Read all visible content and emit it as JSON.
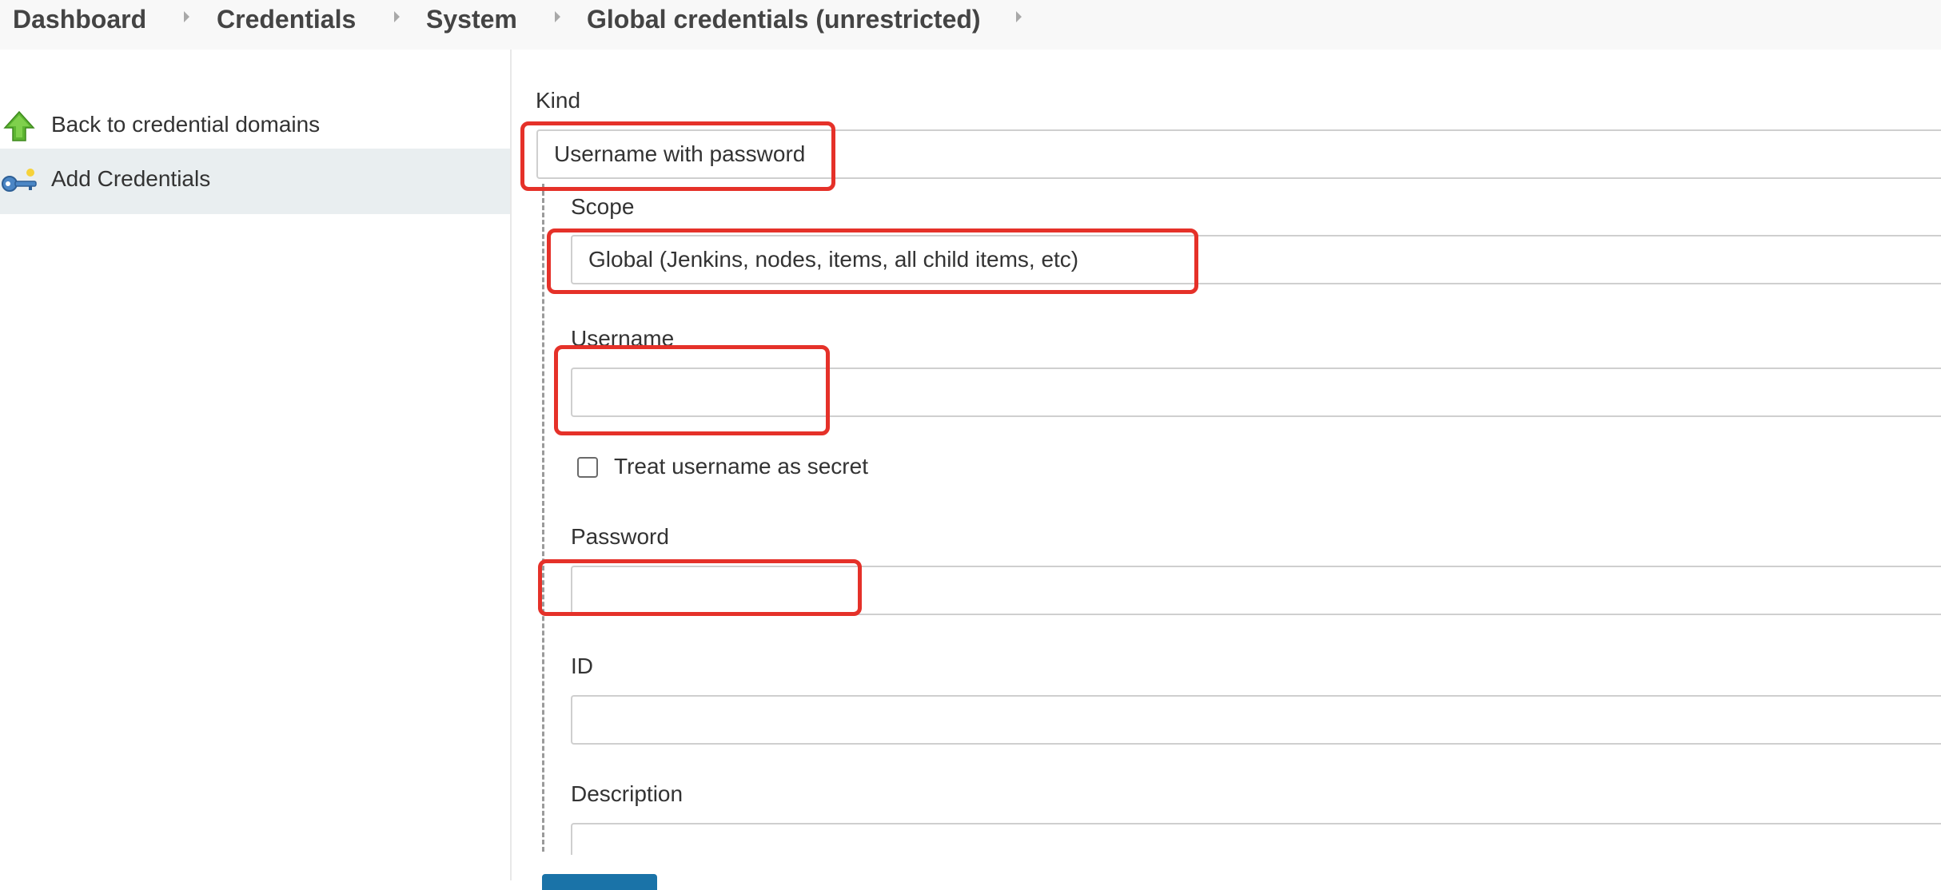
{
  "breadcrumb": {
    "items": [
      "Dashboard",
      "Credentials",
      "System",
      "Global credentials (unrestricted)"
    ]
  },
  "sidebar": {
    "items": [
      {
        "label": "Back to credential domains",
        "icon": "up-arrow-icon"
      },
      {
        "label": "Add Credentials",
        "icon": "key-icon"
      }
    ]
  },
  "form": {
    "kind": {
      "label": "Kind",
      "value": "Username with password"
    },
    "scope": {
      "label": "Scope",
      "value": "Global (Jenkins, nodes, items, all child items, etc)"
    },
    "username": {
      "label": "Username",
      "value": ""
    },
    "treat_username_secret": {
      "label": "Treat username as secret",
      "checked": false
    },
    "password": {
      "label": "Password",
      "value": ""
    },
    "id": {
      "label": "ID",
      "value": ""
    },
    "description": {
      "label": "Description",
      "value": ""
    }
  },
  "colors": {
    "highlight": "#e53129",
    "active_item_bg": "#e9eef0",
    "breadcrumb_bg": "#f8f8f8",
    "button": "#1a73a8"
  }
}
